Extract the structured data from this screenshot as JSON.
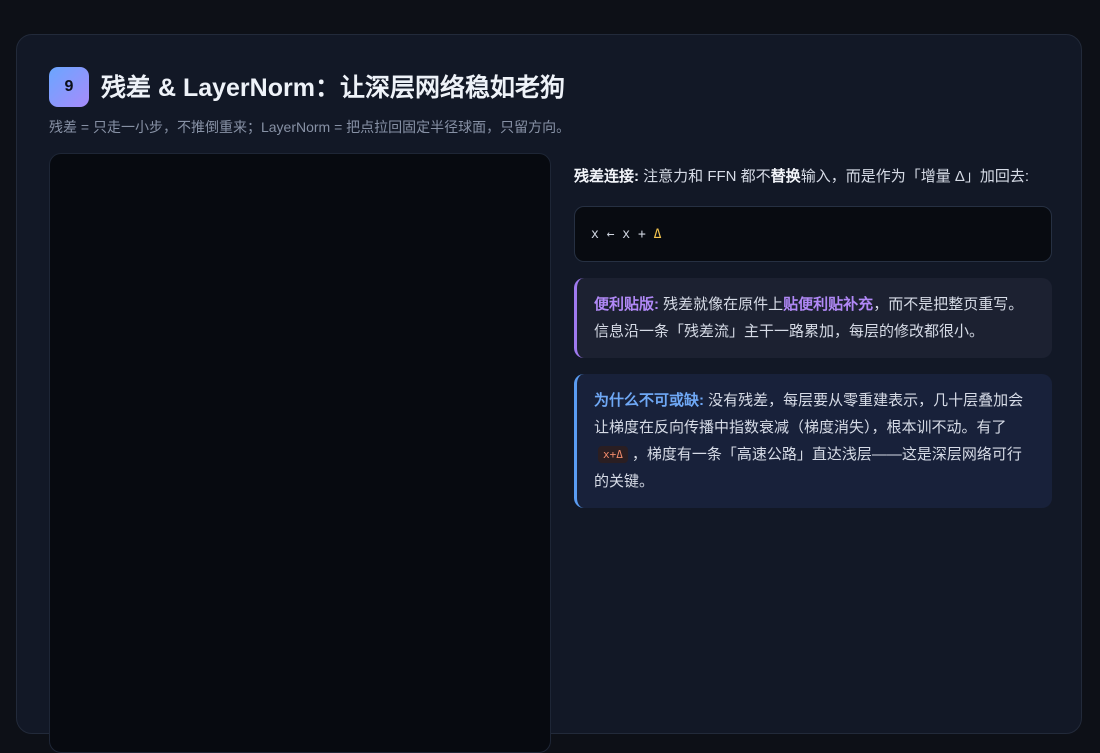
{
  "section": {
    "number": "9",
    "title": "残差 & LayerNorm：让深层网络稳如老狗",
    "subtitle": "残差 = 只走一小步，不推倒重来；LayerNorm = 把点拉回固定半径球面，只留方向。"
  },
  "residual": {
    "label": "残差连接:",
    "text_a": " 注意力和 FFN 都不",
    "emphasis": "替换",
    "text_b": "输入，而是作为「增量 Δ」加回去:",
    "formula_prefix": "x ← x + ",
    "formula_delta": "Δ"
  },
  "sticky_note": {
    "label": "便利贴版:",
    "text_a": " 残差就像在原件上",
    "highlight": "贴便利贴补充",
    "text_b": "，而不是把整页重写。信息沿一条「残差流」主干一路累加，每层的修改都很小。"
  },
  "why_essential": {
    "label": "为什么不可或缺:",
    "text_a": " 没有残差，每层要从零重建表示，几十层叠加会让梯度在反向传播中指数衰减（梯度消失），根本训不动。有了",
    "code": "x+Δ",
    "text_b": "，梯度有一条「高速公路」直达浅层——这是深层网络可行的关键。"
  },
  "colors": {
    "page_bg": "#0d1017",
    "card_bg": "#121826",
    "accent_purple": "#b088f6",
    "accent_blue": "#6fa8f5",
    "delta_yellow": "#f5c64f"
  }
}
